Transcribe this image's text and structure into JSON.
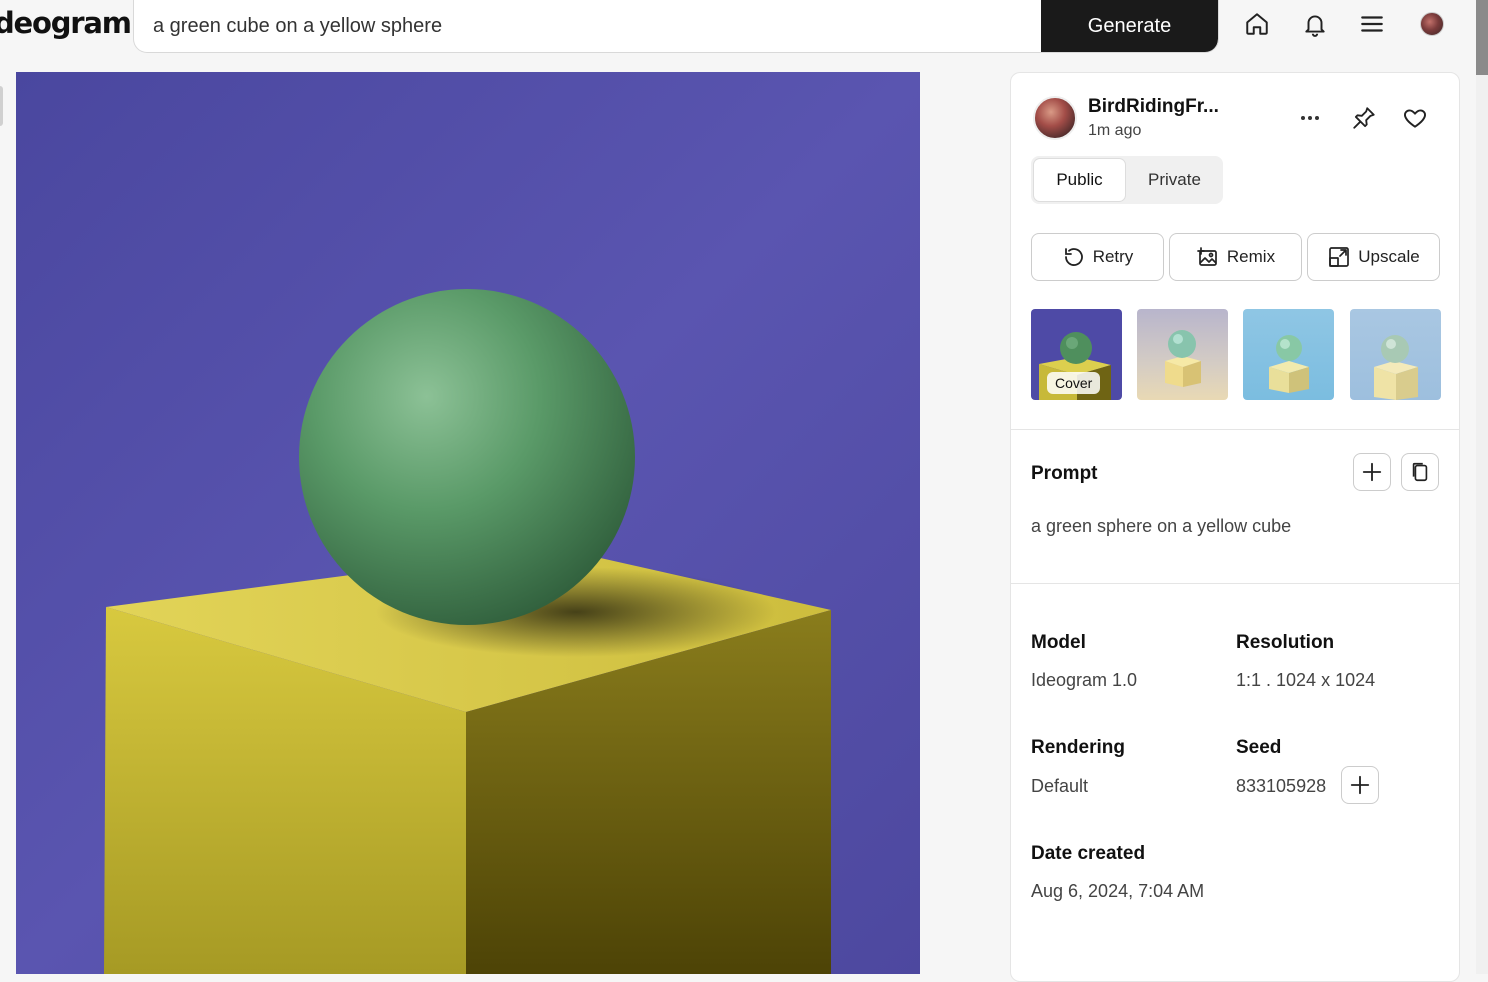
{
  "header": {
    "logo": "deogram",
    "search_value": "a green cube on a yellow sphere",
    "generate_label": "Generate"
  },
  "author": {
    "name": "BirdRidingFr...",
    "time": "1m ago"
  },
  "visibility": {
    "public_label": "Public",
    "private_label": "Private",
    "selected": "Public"
  },
  "actions": {
    "retry": "Retry",
    "remix": "Remix",
    "upscale": "Upscale"
  },
  "thumbnails": {
    "cover_label": "Cover"
  },
  "prompt": {
    "title": "Prompt",
    "text": "a green sphere on a yellow cube"
  },
  "details": {
    "model_label": "Model",
    "model_value": "Ideogram 1.0",
    "resolution_label": "Resolution",
    "resolution_value": "1:1 . 1024 x 1024",
    "rendering_label": "Rendering",
    "rendering_value": "Default",
    "seed_label": "Seed",
    "seed_value": "833105928",
    "date_label": "Date created",
    "date_value": "Aug 6, 2024, 7:04 AM"
  }
}
